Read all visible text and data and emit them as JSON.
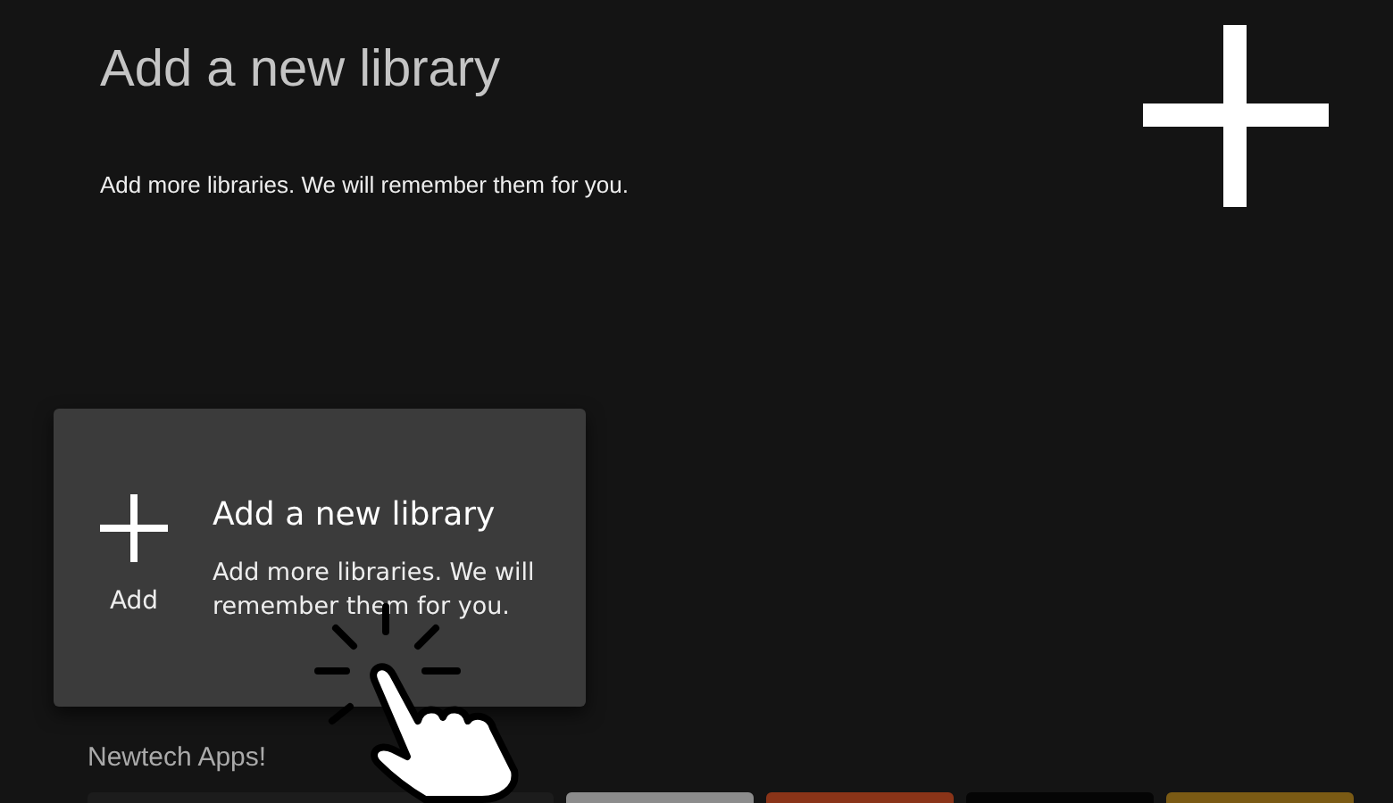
{
  "header": {
    "title": "Add a new library",
    "subtitle": "Add more libraries. We will remember them for you."
  },
  "card": {
    "focused": true,
    "icon_label": "Add",
    "title": "Add a new library",
    "description": "Add more libraries. We will remember them for you."
  },
  "row": {
    "title": "Newtech Apps!",
    "tiles": [
      {
        "color": "#1c1c1c"
      },
      {
        "color": "#8c8c8c"
      },
      {
        "color": "#8a3418"
      },
      {
        "color": "#050505"
      },
      {
        "color": "#7a5a14"
      }
    ]
  }
}
